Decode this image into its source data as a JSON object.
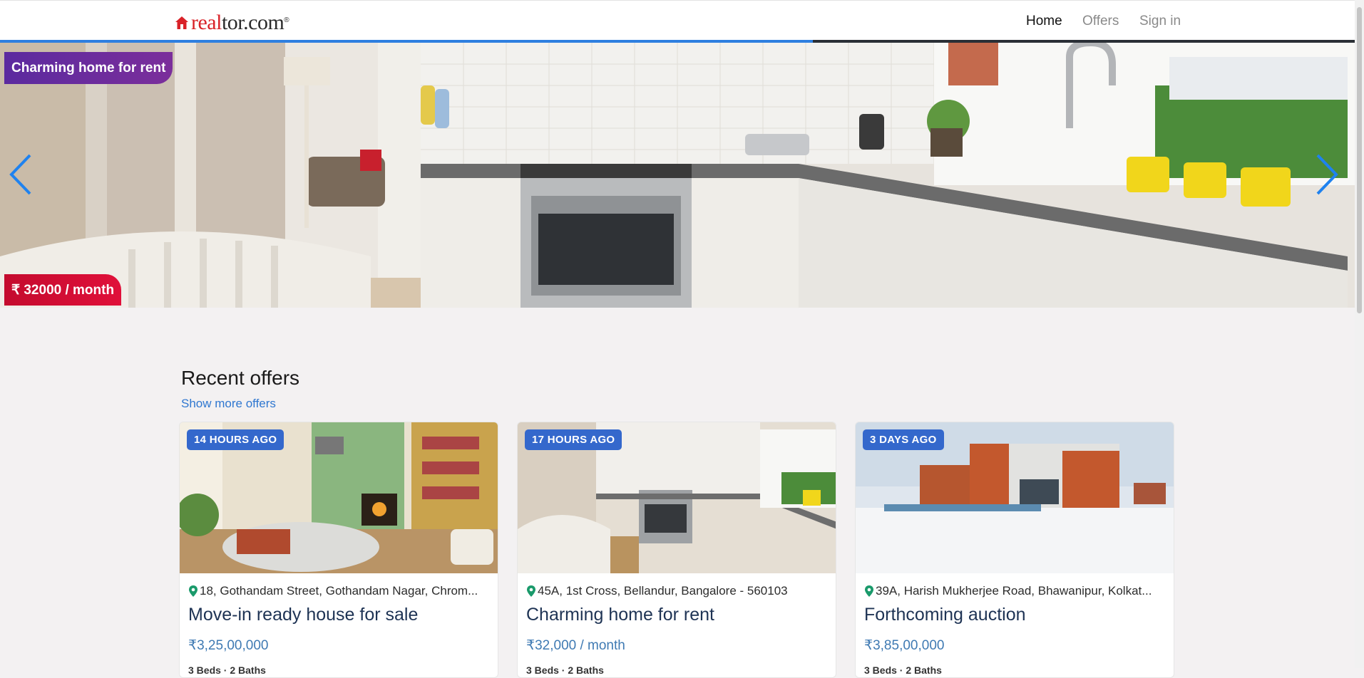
{
  "header": {
    "logo": {
      "real": "real",
      "tor": "tor.com",
      "tm": "®"
    },
    "nav": [
      {
        "label": "Home",
        "active": true
      },
      {
        "label": "Offers",
        "active": false
      },
      {
        "label": "Sign in",
        "active": false
      }
    ]
  },
  "hero": {
    "title_badge": "Charming home for rent",
    "price_badge": "₹ 32000 / month",
    "slide_progress": 0.6,
    "prev_icon": "chevron-left-icon",
    "next_icon": "chevron-right-icon"
  },
  "recent": {
    "title": "Recent offers",
    "show_more": "Show more offers",
    "cards": [
      {
        "age": "14 HOURS AGO",
        "address": "18, Gothandam Street, Gothandam Nagar, Chrom...",
        "title": "Move-in ready house for sale",
        "price": "₹3,25,00,000",
        "specs": "3 Beds · 2 Baths"
      },
      {
        "age": "17 HOURS AGO",
        "address": "45A, 1st Cross, Bellandur, Bangalore - 560103",
        "title": "Charming home for rent",
        "price": "₹32,000 / month",
        "specs": "3 Beds · 2 Baths"
      },
      {
        "age": "3 DAYS AGO",
        "address": "39A, Harish Mukherjee Road, Bhawanipur, Kolkat...",
        "title": "Forthcoming auction",
        "price": "₹3,85,00,000",
        "specs": "3 Beds · 2 Baths"
      }
    ]
  },
  "colors": {
    "brand_red": "#d92228",
    "accent_blue": "#2e7fe0",
    "badge_blue": "#3468cc",
    "price_blue": "#3f7ab3"
  }
}
